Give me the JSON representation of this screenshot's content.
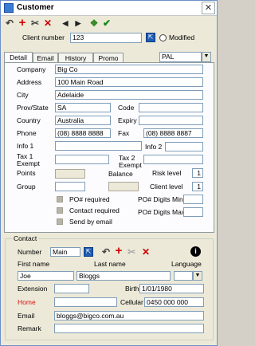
{
  "window": {
    "title": "Customer",
    "close_glyph": "✕"
  },
  "toolbar": {
    "undo": "↶",
    "add": "+",
    "cut": "✂",
    "delete": "✕",
    "prev": "◀",
    "next": "▶",
    "copy": "❖",
    "ok": "✔",
    "colors": {
      "add": "#cc0000",
      "delete": "#cc0000",
      "ok": "#118811",
      "copy": "#3a8a2a"
    }
  },
  "client": {
    "label": "Client number",
    "value": "123",
    "modified_label": "Modified"
  },
  "tabs": [
    "Detail",
    "Email",
    "History",
    "Promo"
  ],
  "pricelist": {
    "value": "PAL"
  },
  "detail": {
    "company_label": "Company",
    "company": "Big Co",
    "address_label": "Address",
    "address": "100 Main Road",
    "city_label": "City",
    "city": "Adelaide",
    "prov_label": "Prov/State",
    "prov": "SA",
    "code_label": "Code",
    "code": "",
    "country_label": "Country",
    "country": "Australia",
    "expiry_label": "Expiry",
    "expiry": "",
    "phone_label": "Phone",
    "phone": "(08) 8888 8888",
    "fax_label": "Fax",
    "fax": "(08) 8888 8887",
    "info1_label": "Info 1",
    "info1": "",
    "info2_label": "Info 2",
    "info2": "",
    "tax1_label": "Tax 1",
    "tax1_label2": "Exempt",
    "tax2_label": "Tax 2",
    "tax2_label2": "Exempt",
    "points_label": "Points",
    "balance_label": "Balance",
    "risk_label": "Risk level",
    "risk": "1",
    "group_label": "Group",
    "client_level_label": "Client level",
    "client_level": "1",
    "po_required_label": "PO# required",
    "contact_required_label": "Contact required",
    "send_email_label": "Send by email",
    "po_min_label": "PO# Digits Min",
    "po_max_label": "PO# Digits Max"
  },
  "contact": {
    "group_label": "Contact",
    "number_label": "Number",
    "number": "Main",
    "first_name_label": "First name",
    "first_name": "Joe",
    "last_name_label": "Last name",
    "last_name": "Bloggs",
    "language_label": "Language",
    "extension_label": "Extension",
    "birth_label": "Birth",
    "birth": "1/01/1980",
    "home_label": "Home",
    "cellular_label": "Cellular",
    "cellular": "0450 000 000",
    "email_label": "Email",
    "email": "bloggs@bigco.com.au",
    "remark_label": "Remark",
    "home_color": "#dd1111"
  }
}
